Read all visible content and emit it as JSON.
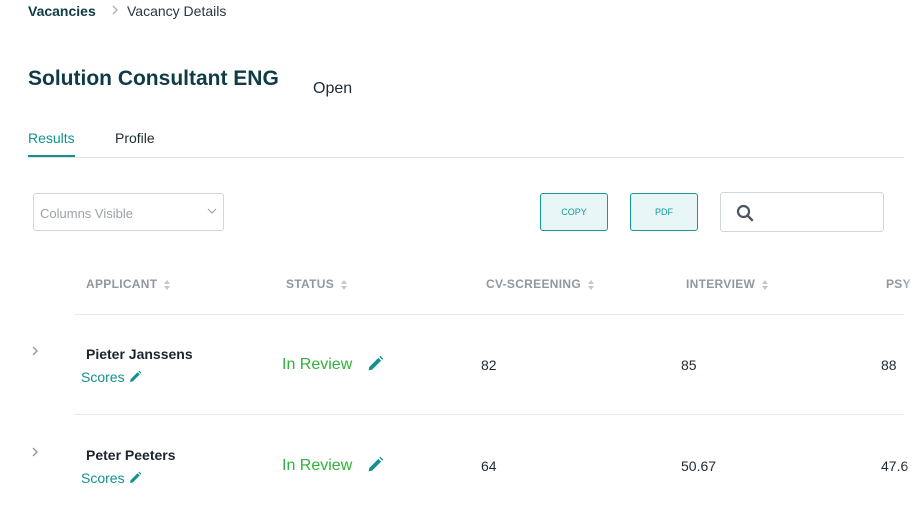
{
  "breadcrumb": {
    "root": "Vacancies",
    "separator": ">",
    "current": "Vacancy Details"
  },
  "vacancy": {
    "title": "Solution Consultant ENG",
    "status": "Open"
  },
  "tabs": [
    {
      "label": "Results",
      "active": true
    },
    {
      "label": "Profile",
      "active": false
    }
  ],
  "toolbar": {
    "columns_placeholder": "Columns Visible",
    "copy_label": "COPY",
    "pdf_label": "PDF",
    "search_value": ""
  },
  "table": {
    "headers": [
      "APPLICANT",
      "STATUS",
      "CV-SCREENING",
      "INTERVIEW",
      "PSY"
    ],
    "rows": [
      {
        "name": "Pieter Janssens",
        "scores_label": "Scores",
        "status": "In Review",
        "cv_screening": "82",
        "interview": "85",
        "psy": "88"
      },
      {
        "name": "Peter Peeters",
        "scores_label": "Scores",
        "status": "In Review",
        "cv_screening": "64",
        "interview": "50.67",
        "psy": "47.6"
      }
    ]
  },
  "colors": {
    "brand_dark": "#0f3b46",
    "accent_teal": "#12918f",
    "status_green": "#2fb33a",
    "header_grey": "#8f98a0"
  }
}
